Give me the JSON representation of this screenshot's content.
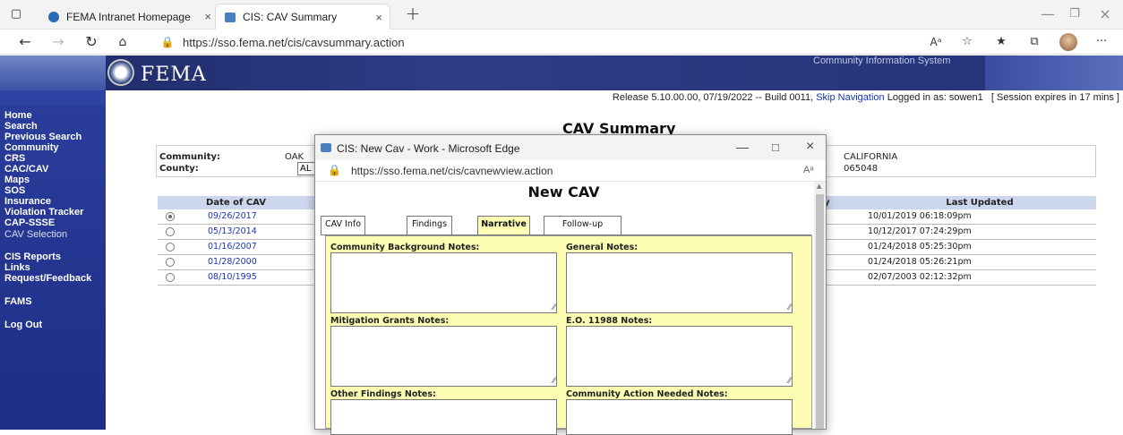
{
  "browser": {
    "tabs": [
      {
        "label": "FEMA Intranet Homepage"
      },
      {
        "label": "CIS: CAV Summary"
      }
    ],
    "url": "https://sso.fema.net/cis/cavsummary.action",
    "read_aloud": "Aᵃ",
    "more": "···"
  },
  "banner": {
    "logo_text": "FEMA",
    "system_title": "Community Information System"
  },
  "infoline": {
    "release": "Release 5.10.00.00, 07/19/2022 -- Build 0011,",
    "skip_nav": "Skip Navigation",
    "logged_in": "Logged in as: sowen1",
    "session": "[ Session expires in 17 mins ]"
  },
  "sidebar": {
    "items": [
      {
        "label": "Home"
      },
      {
        "label": "Search"
      },
      {
        "label": "Previous Search"
      },
      {
        "label": "Community"
      },
      {
        "label": "CRS"
      },
      {
        "label": "CAC/CAV"
      },
      {
        "label": "Maps"
      },
      {
        "label": "SOS"
      },
      {
        "label": "Insurance"
      },
      {
        "label": "Violation Tracker"
      },
      {
        "label": "CAP-SSSE"
      },
      {
        "label": "CAV Selection"
      },
      {
        "label": "CIS Reports"
      },
      {
        "label": "Links"
      },
      {
        "label": "Request/Feedback"
      },
      {
        "label": "FAMS"
      },
      {
        "label": "Log Out"
      }
    ]
  },
  "summary": {
    "title": "CAV Summary",
    "community_label": "Community:",
    "community_value": "OAK",
    "county_label": "County:",
    "county_value": "AL",
    "state": "CALIFORNIA",
    "cid": "065048",
    "col_date": "Date of CAV",
    "col_by": "y",
    "col_updated": "Last Updated",
    "rows": [
      {
        "date": "09/26/2017",
        "updated": "10/01/2019 06:18:09pm",
        "selected": true
      },
      {
        "date": "05/13/2014",
        "updated": "10/12/2017 07:24:29pm",
        "selected": false
      },
      {
        "date": "01/16/2007",
        "updated": "01/24/2018 05:25:30pm",
        "selected": false
      },
      {
        "date": "01/28/2000",
        "updated": "01/24/2018 05:26:21pm",
        "selected": false
      },
      {
        "date": "08/10/1995",
        "updated": "02/07/2003 02:12:32pm",
        "selected": false
      }
    ]
  },
  "popup": {
    "window_title": "CIS: New Cav - Work - Microsoft Edge",
    "url": "https://sso.fema.net/cis/cavnewview.action",
    "read_aloud": "Aᵃ",
    "heading": "New CAV",
    "tabs": [
      {
        "label": "CAV Info"
      },
      {
        "label": "Findings"
      },
      {
        "label": "Narrative"
      },
      {
        "label": "Follow-up"
      }
    ],
    "notes": {
      "community_background": "Community Background Notes:",
      "general": "General Notes:",
      "mitigation_grants": "Mitigation Grants Notes:",
      "eo_11988": "E.O. 11988 Notes:",
      "other_findings": "Other Findings Notes:",
      "community_action": "Community Action Needed Notes:"
    }
  }
}
